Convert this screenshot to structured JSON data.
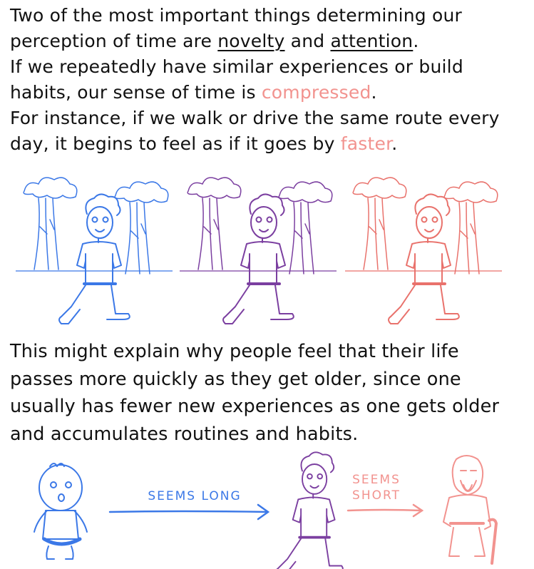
{
  "text": {
    "p1_a": "Two of the most important things determining our perception of time are ",
    "novelty": "novelty",
    "and": " and ",
    "attention": "attention",
    "p1_b": ".",
    "p1_c": "If we repeatedly have similar experiences or build habits, our sense of time is ",
    "compressed": "compressed",
    "p1_d": ".",
    "p1_e": "For instance, if we walk or drive the same route every day, it begins to feel as if it goes by ",
    "faster": "faster",
    "p1_f": ".",
    "p2": "This might explain why people feel that their life passes more quickly as they get older, since one usually has fewer new experiences as one gets older and accumulates routines and habits."
  },
  "labels": {
    "seems_long": "SEEMS LONG",
    "seems_short_1": "SEEMS",
    "seems_short_2": "SHORT"
  },
  "colors": {
    "blue": "#3b78e7",
    "purple": "#7b3fa0",
    "pink": "#f2938f",
    "red": "#e9726c",
    "ink": "#111111"
  }
}
